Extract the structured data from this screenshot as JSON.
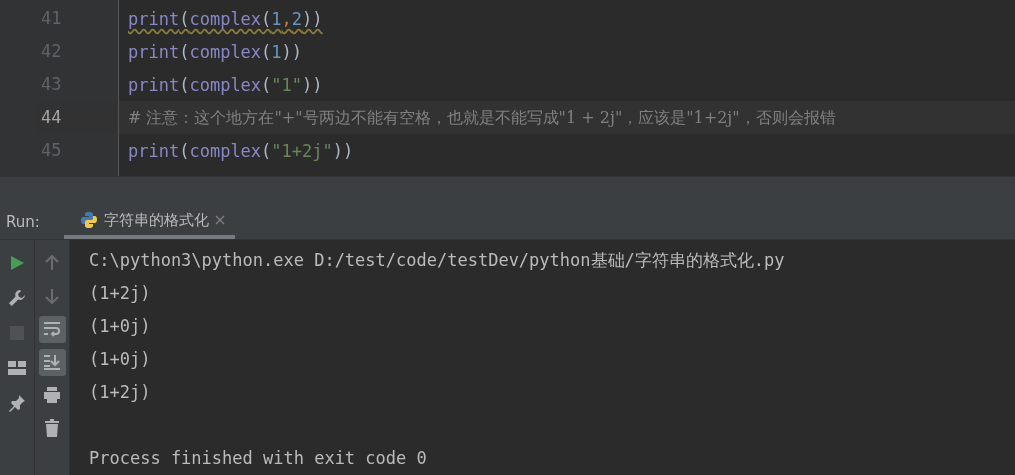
{
  "editor": {
    "lines": [
      {
        "number": "41",
        "current": false,
        "warning": true,
        "tokens": [
          {
            "kind": "builtin",
            "text": "print"
          },
          {
            "kind": "plain",
            "text": "("
          },
          {
            "kind": "builtin",
            "text": "complex"
          },
          {
            "kind": "plain",
            "text": "("
          },
          {
            "kind": "number",
            "text": "1"
          },
          {
            "kind": "comma",
            "text": ","
          },
          {
            "kind": "number",
            "text": "2"
          },
          {
            "kind": "plain",
            "text": "))"
          }
        ]
      },
      {
        "number": "42",
        "current": false,
        "warning": false,
        "tokens": [
          {
            "kind": "builtin",
            "text": "print"
          },
          {
            "kind": "plain",
            "text": "("
          },
          {
            "kind": "builtin",
            "text": "complex"
          },
          {
            "kind": "plain",
            "text": "("
          },
          {
            "kind": "number",
            "text": "1"
          },
          {
            "kind": "plain",
            "text": "))"
          }
        ]
      },
      {
        "number": "43",
        "current": false,
        "warning": false,
        "tokens": [
          {
            "kind": "builtin",
            "text": "print"
          },
          {
            "kind": "plain",
            "text": "("
          },
          {
            "kind": "builtin",
            "text": "complex"
          },
          {
            "kind": "plain",
            "text": "("
          },
          {
            "kind": "string",
            "text": "\"1\""
          },
          {
            "kind": "plain",
            "text": "))"
          }
        ]
      },
      {
        "number": "44",
        "current": true,
        "warning": false,
        "tokens": [
          {
            "kind": "comment",
            "text": "# 注意：这个地方在\"+\"号两边不能有空格，也就是不能写成\"1 + 2j\"，应该是\"1+2j\"，否则会报错"
          }
        ]
      },
      {
        "number": "45",
        "current": false,
        "warning": false,
        "tokens": [
          {
            "kind": "builtin",
            "text": "print"
          },
          {
            "kind": "plain",
            "text": "("
          },
          {
            "kind": "builtin",
            "text": "complex"
          },
          {
            "kind": "plain",
            "text": "("
          },
          {
            "kind": "string",
            "text": "\"1+2j\""
          },
          {
            "kind": "plain",
            "text": "))"
          }
        ]
      }
    ]
  },
  "run": {
    "label": "Run:",
    "tabs": [
      {
        "title": "字符串的格式化",
        "selected": true
      }
    ],
    "left_tools": [
      {
        "kind": "run",
        "disabled": false
      },
      {
        "kind": "wrench",
        "disabled": false
      },
      {
        "kind": "stop",
        "disabled": true
      },
      {
        "kind": "layout",
        "disabled": false
      },
      {
        "kind": "pin",
        "disabled": false
      }
    ],
    "right_tools": [
      {
        "kind": "up",
        "disabled": true,
        "on": false
      },
      {
        "kind": "down",
        "disabled": true,
        "on": false
      },
      {
        "kind": "wrap",
        "disabled": false,
        "on": true
      },
      {
        "kind": "scroll",
        "disabled": false,
        "on": true
      },
      {
        "kind": "print",
        "disabled": false,
        "on": false
      },
      {
        "kind": "trash",
        "disabled": false,
        "on": false
      }
    ],
    "output": [
      "C:\\python3\\python.exe D:/test/code/testDev/python基础/字符串的格式化.py",
      "(1+2j)",
      "(1+0j)",
      "(1+0j)",
      "(1+2j)"
    ],
    "exit_message": "Process finished with exit code 0"
  }
}
